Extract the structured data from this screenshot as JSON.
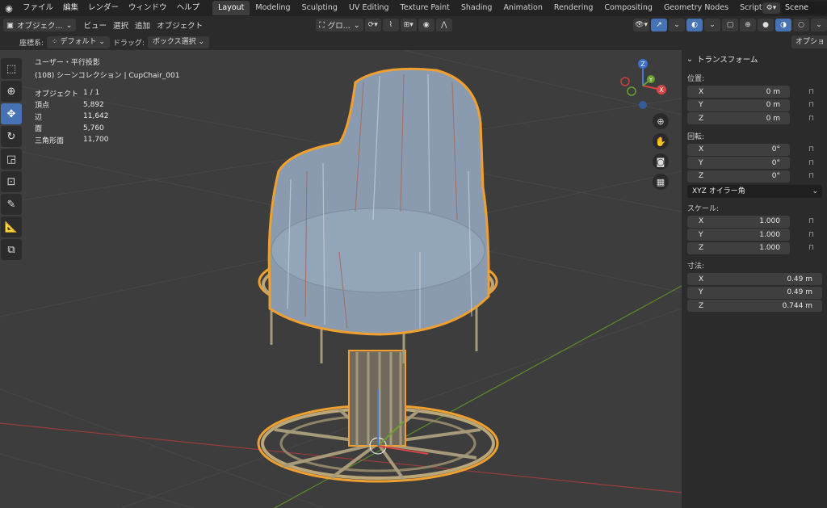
{
  "menubar": {
    "items": [
      "ファイル",
      "編集",
      "レンダー",
      "ウィンドウ",
      "ヘルプ"
    ],
    "workspaces": [
      "Layout",
      "Modeling",
      "Sculpting",
      "UV Editing",
      "Texture Paint",
      "Shading",
      "Animation",
      "Rendering",
      "Compositing",
      "Geometry Nodes",
      "Scripting"
    ],
    "active_workspace": "Layout",
    "scene": "Scene"
  },
  "header": {
    "mode": "オブジェク...",
    "menus": [
      "ビュー",
      "選択",
      "追加",
      "オブジェクト"
    ],
    "orientation": "グロ..."
  },
  "toolsettings": {
    "coord_label": "座標系:",
    "coord_value": "デフォルト",
    "drag_label": "ドラッグ:",
    "drag_value": "ボックス選択",
    "options": "オプション"
  },
  "viewport": {
    "view_name": "ユーザー・平行投影",
    "collection": "(108) シーンコレクション | CupChair_001",
    "stats": [
      {
        "label": "オブジェクト",
        "value": "1 / 1"
      },
      {
        "label": "頂点",
        "value": "5,892"
      },
      {
        "label": "辺",
        "value": "11,642"
      },
      {
        "label": "面",
        "value": "5,760"
      },
      {
        "label": "三角形面",
        "value": "11,700"
      }
    ],
    "gizmo": {
      "x": "X",
      "y": "Y",
      "z": "Z"
    }
  },
  "npanel": {
    "title": "トランスフォーム",
    "location_label": "位置:",
    "location": [
      {
        "axis": "X",
        "value": "0 m"
      },
      {
        "axis": "Y",
        "value": "0 m"
      },
      {
        "axis": "Z",
        "value": "0 m"
      }
    ],
    "rotation_label": "回転:",
    "rotation": [
      {
        "axis": "X",
        "value": "0°"
      },
      {
        "axis": "Y",
        "value": "0°"
      },
      {
        "axis": "Z",
        "value": "0°"
      }
    ],
    "rotation_mode": "XYZ オイラー角",
    "scale_label": "スケール:",
    "scale": [
      {
        "axis": "X",
        "value": "1.000"
      },
      {
        "axis": "Y",
        "value": "1.000"
      },
      {
        "axis": "Z",
        "value": "1.000"
      }
    ],
    "dimensions_label": "寸法:",
    "dimensions": [
      {
        "axis": "X",
        "value": "0.49 m"
      },
      {
        "axis": "Y",
        "value": "0.49 m"
      },
      {
        "axis": "Z",
        "value": "0.744 m"
      }
    ]
  },
  "colors": {
    "accent": "#4772b3",
    "selection": "#f0a030"
  }
}
